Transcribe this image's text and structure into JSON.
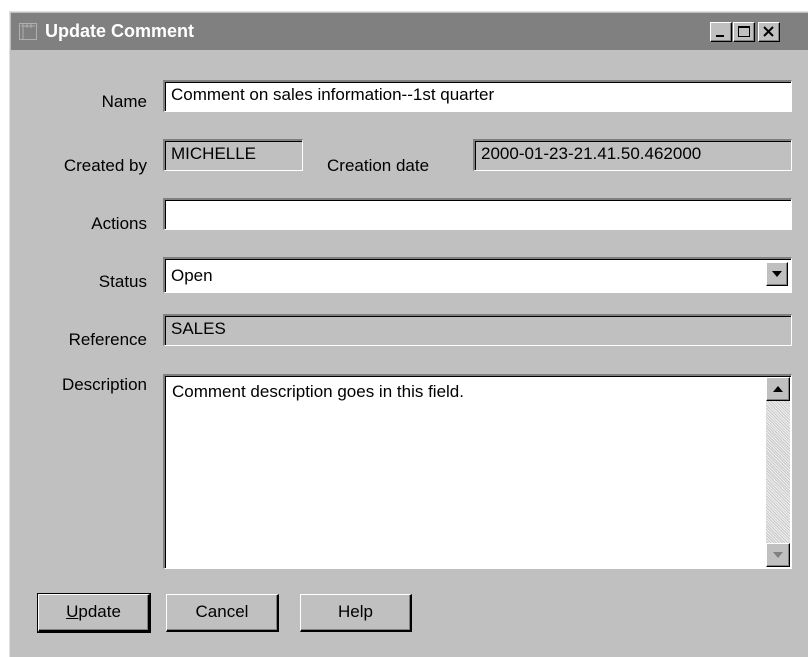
{
  "window": {
    "title": "Update Comment"
  },
  "form": {
    "name_label": "Name",
    "name_value": "Comment on sales information--1st quarter",
    "created_by_label": "Created by",
    "created_by_value": "MICHELLE",
    "creation_date_label": "Creation date",
    "creation_date_value": "2000-01-23-21.41.50.462000",
    "actions_label": "Actions",
    "actions_value": "",
    "status_label": "Status",
    "status_value": "Open",
    "reference_label": "Reference",
    "reference_value": "SALES",
    "description_label": "Description",
    "description_value": "Comment description goes in this field."
  },
  "buttons": {
    "update_mnemonic": "U",
    "update_rest": "pdate",
    "cancel": "Cancel",
    "help": "Help"
  },
  "icons": {
    "window_icon": "dialog-icon",
    "minimize": "minimize-icon",
    "maximize": "maximize-icon",
    "close": "close-icon",
    "dropdown": "chevron-down-icon",
    "scroll_up": "arrow-up-icon",
    "scroll_down": "arrow-down-icon"
  },
  "colors": {
    "titlebar": "#808080",
    "window_bg": "#c0c0c0",
    "field_bg": "#ffffff"
  }
}
